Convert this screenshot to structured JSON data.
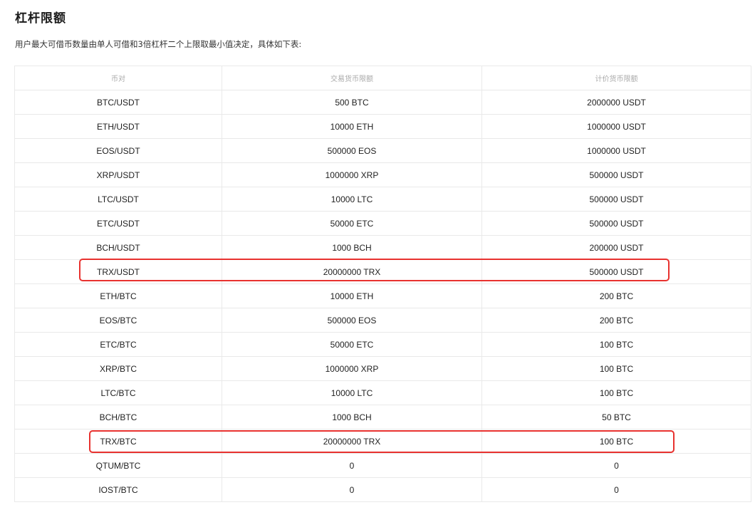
{
  "header": {
    "title": "杠杆限额",
    "description": "用户最大可借币数量由单人可借和3倍杠杆二个上限取最小值决定，具体如下表:"
  },
  "table": {
    "columns": [
      "币对",
      "交易货币限额",
      "计价货币限额"
    ],
    "rows": [
      {
        "pair": "BTC/USDT",
        "trade_limit": "500 BTC",
        "quote_limit": "2000000 USDT"
      },
      {
        "pair": "ETH/USDT",
        "trade_limit": "10000 ETH",
        "quote_limit": "1000000 USDT"
      },
      {
        "pair": "EOS/USDT",
        "trade_limit": "500000 EOS",
        "quote_limit": "1000000 USDT"
      },
      {
        "pair": "XRP/USDT",
        "trade_limit": "1000000 XRP",
        "quote_limit": "500000 USDT"
      },
      {
        "pair": "LTC/USDT",
        "trade_limit": "10000 LTC",
        "quote_limit": "500000 USDT"
      },
      {
        "pair": "ETC/USDT",
        "trade_limit": "50000 ETC",
        "quote_limit": "500000 USDT"
      },
      {
        "pair": "BCH/USDT",
        "trade_limit": "1000 BCH",
        "quote_limit": "200000 USDT"
      },
      {
        "pair": "TRX/USDT",
        "trade_limit": "20000000 TRX",
        "quote_limit": "500000 USDT"
      },
      {
        "pair": "ETH/BTC",
        "trade_limit": "10000 ETH",
        "quote_limit": "200 BTC"
      },
      {
        "pair": "EOS/BTC",
        "trade_limit": "500000 EOS",
        "quote_limit": "200 BTC"
      },
      {
        "pair": "ETC/BTC",
        "trade_limit": "50000 ETC",
        "quote_limit": "100 BTC"
      },
      {
        "pair": "XRP/BTC",
        "trade_limit": "1000000 XRP",
        "quote_limit": "100 BTC"
      },
      {
        "pair": "LTC/BTC",
        "trade_limit": "10000 LTC",
        "quote_limit": "100 BTC"
      },
      {
        "pair": "BCH/BTC",
        "trade_limit": "1000 BCH",
        "quote_limit": "50 BTC"
      },
      {
        "pair": "TRX/BTC",
        "trade_limit": "20000000 TRX",
        "quote_limit": "100 BTC"
      },
      {
        "pair": "QTUM/BTC",
        "trade_limit": "0",
        "quote_limit": "0"
      },
      {
        "pair": "IOST/BTC",
        "trade_limit": "0",
        "quote_limit": "0"
      }
    ]
  },
  "highlights": {
    "color": "#e8322f"
  }
}
